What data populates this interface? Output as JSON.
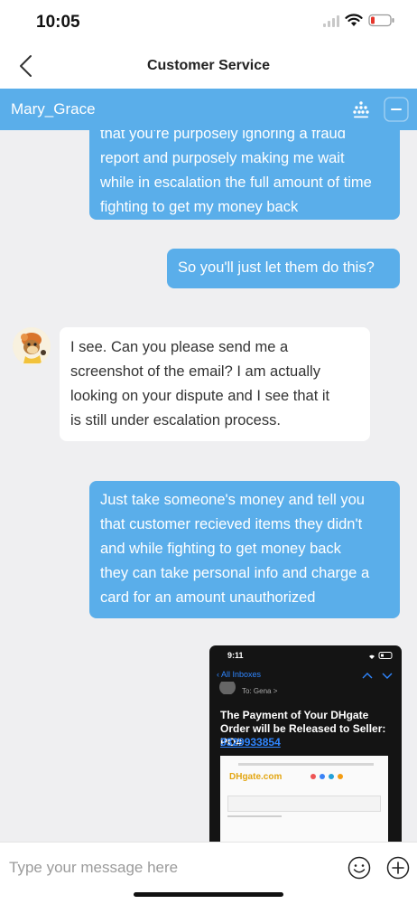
{
  "status_bar": {
    "time": "10:05"
  },
  "nav": {
    "title": "Customer Service"
  },
  "chat_header": {
    "agent_name": "Mary_Grace"
  },
  "messages": [
    {
      "sender": "user",
      "lines": [
        "that you're purposely ignoring a fraud",
        "report and purposely making me wait",
        "while in escalation the full amount of time",
        "fighting to get my money back"
      ]
    },
    {
      "sender": "user",
      "lines": [
        "So you'll just let them do this?"
      ]
    },
    {
      "sender": "agent",
      "lines": [
        "I see. Can you please send me a",
        "screenshot of the email? I am actually",
        "looking on your dispute and I see that it",
        "is still under escalation process."
      ]
    },
    {
      "sender": "user",
      "lines": [
        "Just take someone's money and tell you",
        "that customer recieved items they didn't",
        "and while fighting to get money back",
        "they can take personal info and charge a",
        "card for an amount unauthorized"
      ]
    }
  ],
  "attachment": {
    "time": "9:11",
    "inbox_label": "All Inboxes",
    "to_label": "To: Gena >",
    "subject": "The Payment of Your DHgate Order will be Released to Seller: PO#",
    "po_number": "3329933854",
    "logo_text": "DHgate.com"
  },
  "composer": {
    "placeholder": "Type your message here"
  },
  "colors": {
    "accent": "#5aaeea",
    "background": "#efeff1"
  }
}
